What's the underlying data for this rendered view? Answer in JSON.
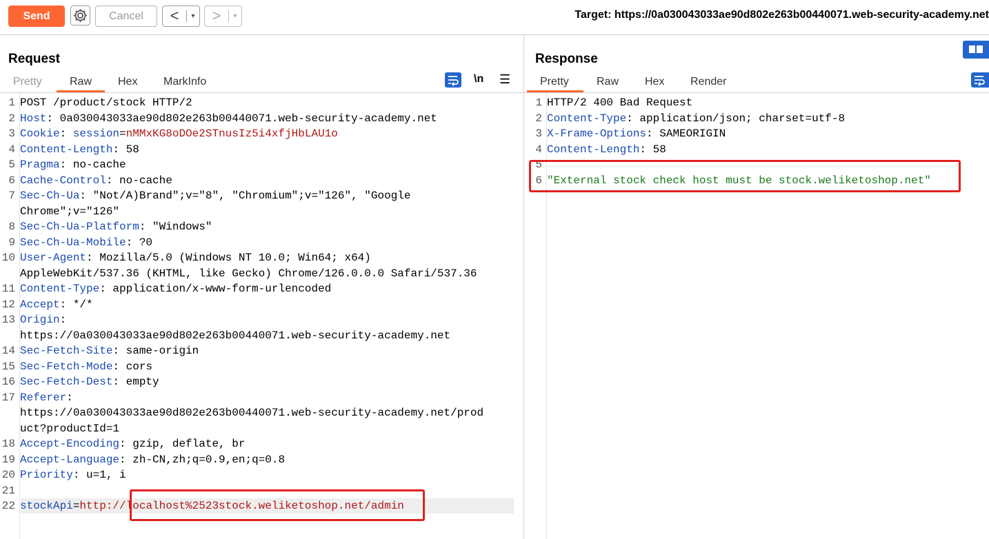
{
  "toolbar": {
    "send_label": "Send",
    "cancel_label": "Cancel",
    "back_label": "<",
    "forward_label": ">",
    "dropdown_glyph": "▾",
    "target_text": "Target: https://0a030043033ae90d802e263b00440071.web-security-academy.net"
  },
  "request": {
    "title": "Request",
    "tabs": [
      "Pretty",
      "Raw",
      "Hex",
      "MarkInfo"
    ],
    "active_tab": "Raw",
    "newline_label": "\\n",
    "menu_glyph": "☰",
    "lines": [
      {
        "n": "1",
        "k": "",
        "sep": "",
        "v": "POST /product/stock HTTP/2",
        "vc": "plain"
      },
      {
        "n": "2",
        "k": "Host",
        "sep": ": ",
        "v": "0a030043033ae90d802e263b00440071.web-security-academy.net",
        "vc": "plain"
      },
      {
        "n": "3",
        "k": "Cookie",
        "sep": ": ",
        "k2": "session",
        "sep2": "=",
        "v": "nMMxKG8oDOe2STnusIz5i4xfjHbLAU1o",
        "vc": "red"
      },
      {
        "n": "4",
        "k": "Content-Length",
        "sep": ": ",
        "v": "58",
        "vc": "plain"
      },
      {
        "n": "5",
        "k": "Pragma",
        "sep": ": ",
        "v": "no-cache",
        "vc": "plain"
      },
      {
        "n": "6",
        "k": "Cache-Control",
        "sep": ": ",
        "v": "no-cache",
        "vc": "plain"
      },
      {
        "n": "7",
        "k": "Sec-Ch-Ua",
        "sep": ": ",
        "v": "\"Not/A)Brand\";v=\"8\", \"Chromium\";v=\"126\", \"Google",
        "vc": "plain"
      },
      {
        "n": "",
        "k": "",
        "sep": "",
        "v": "Chrome\";v=\"126\"",
        "vc": "plain"
      },
      {
        "n": "8",
        "k": "Sec-Ch-Ua-Platform",
        "sep": ": ",
        "v": "\"Windows\"",
        "vc": "plain"
      },
      {
        "n": "9",
        "k": "Sec-Ch-Ua-Mobile",
        "sep": ": ",
        "v": "?0",
        "vc": "plain"
      },
      {
        "n": "10",
        "k": "User-Agent",
        "sep": ": ",
        "v": "Mozilla/5.0 (Windows NT 10.0; Win64; x64)",
        "vc": "plain"
      },
      {
        "n": "",
        "k": "",
        "sep": "",
        "v": "AppleWebKit/537.36 (KHTML, like Gecko) Chrome/126.0.0.0 Safari/537.36",
        "vc": "plain"
      },
      {
        "n": "11",
        "k": "Content-Type",
        "sep": ": ",
        "v": "application/x-www-form-urlencoded",
        "vc": "plain"
      },
      {
        "n": "12",
        "k": "Accept",
        "sep": ": ",
        "v": "*/*",
        "vc": "plain"
      },
      {
        "n": "13",
        "k": "Origin",
        "sep": ":",
        "v": "",
        "vc": "plain"
      },
      {
        "n": "",
        "k": "",
        "sep": "",
        "v": "https://0a030043033ae90d802e263b00440071.web-security-academy.net",
        "vc": "plain"
      },
      {
        "n": "14",
        "k": "Sec-Fetch-Site",
        "sep": ": ",
        "v": "same-origin",
        "vc": "plain"
      },
      {
        "n": "15",
        "k": "Sec-Fetch-Mode",
        "sep": ": ",
        "v": "cors",
        "vc": "plain"
      },
      {
        "n": "16",
        "k": "Sec-Fetch-Dest",
        "sep": ": ",
        "v": "empty",
        "vc": "plain"
      },
      {
        "n": "17",
        "k": "Referer",
        "sep": ":",
        "v": "",
        "vc": "plain"
      },
      {
        "n": "",
        "k": "",
        "sep": "",
        "v": "https://0a030043033ae90d802e263b00440071.web-security-academy.net/prod",
        "vc": "plain"
      },
      {
        "n": "",
        "k": "",
        "sep": "",
        "v": "uct?productId=1",
        "vc": "plain"
      },
      {
        "n": "18",
        "k": "Accept-Encoding",
        "sep": ": ",
        "v": "gzip, deflate, br",
        "vc": "plain"
      },
      {
        "n": "19",
        "k": "Accept-Language",
        "sep": ": ",
        "v": "zh-CN,zh;q=0.9,en;q=0.8",
        "vc": "plain"
      },
      {
        "n": "20",
        "k": "Priority",
        "sep": ": ",
        "v": "u=1, i",
        "vc": "plain"
      },
      {
        "n": "21",
        "k": "",
        "sep": "",
        "v": "",
        "vc": "plain"
      },
      {
        "n": "22",
        "k": "stockApi",
        "sep": "=",
        "v": "http://localhost%2523stock.weliketoshop.net/admin",
        "vc": "red"
      }
    ]
  },
  "response": {
    "title": "Response",
    "tabs": [
      "Pretty",
      "Raw",
      "Hex",
      "Render"
    ],
    "active_tab": "Pretty",
    "lines": [
      {
        "n": "1",
        "k": "",
        "sep": "",
        "v": "HTTP/2 400 Bad Request",
        "vc": "plain"
      },
      {
        "n": "2",
        "k": "Content-Type",
        "sep": ": ",
        "v": "application/json; charset=utf-8",
        "vc": "plain"
      },
      {
        "n": "3",
        "k": "X-Frame-Options",
        "sep": ": ",
        "v": "SAMEORIGIN",
        "vc": "plain"
      },
      {
        "n": "4",
        "k": "Content-Length",
        "sep": ": ",
        "v": "58",
        "vc": "plain"
      },
      {
        "n": "5",
        "k": "",
        "sep": "",
        "v": "",
        "vc": "plain"
      },
      {
        "n": "6",
        "k": "",
        "sep": "",
        "v": "\"External stock check host must be stock.weliketoshop.net\"",
        "vc": "green"
      }
    ]
  },
  "colors": {
    "accent": "#ff6633",
    "header_key": "#1a4ab0",
    "value_red": "#b01818",
    "string_green": "#1a7a1a",
    "highlight_box": "#e02020",
    "icon_blue": "#2266cc"
  }
}
